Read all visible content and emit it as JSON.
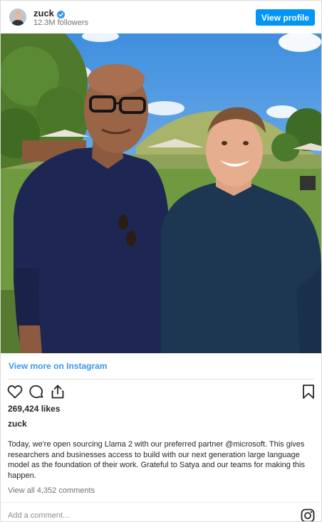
{
  "header": {
    "username": "zuck",
    "followers": "12.3M followers",
    "view_profile_label": "View profile",
    "verified_color": "#3897f0"
  },
  "post": {
    "view_more_label": "View more on Instagram",
    "likes": "269,424 likes",
    "author": "zuck",
    "caption": "Today, we're open sourcing Llama 2 with our preferred partner @microsoft. This gives researchers and businesses access to build with our next generation large language model as the foundation of their work. Grateful to Satya and our teams for making this happen.",
    "view_comments": "View all 4,352 comments",
    "add_comment_placeholder": "Add a comment..."
  },
  "icons": [
    "heart-icon",
    "comment-icon",
    "share-icon",
    "bookmark-icon",
    "instagram-icon",
    "verified-icon"
  ],
  "colors": {
    "accent": "#0095f6",
    "link": "#3897f0"
  }
}
